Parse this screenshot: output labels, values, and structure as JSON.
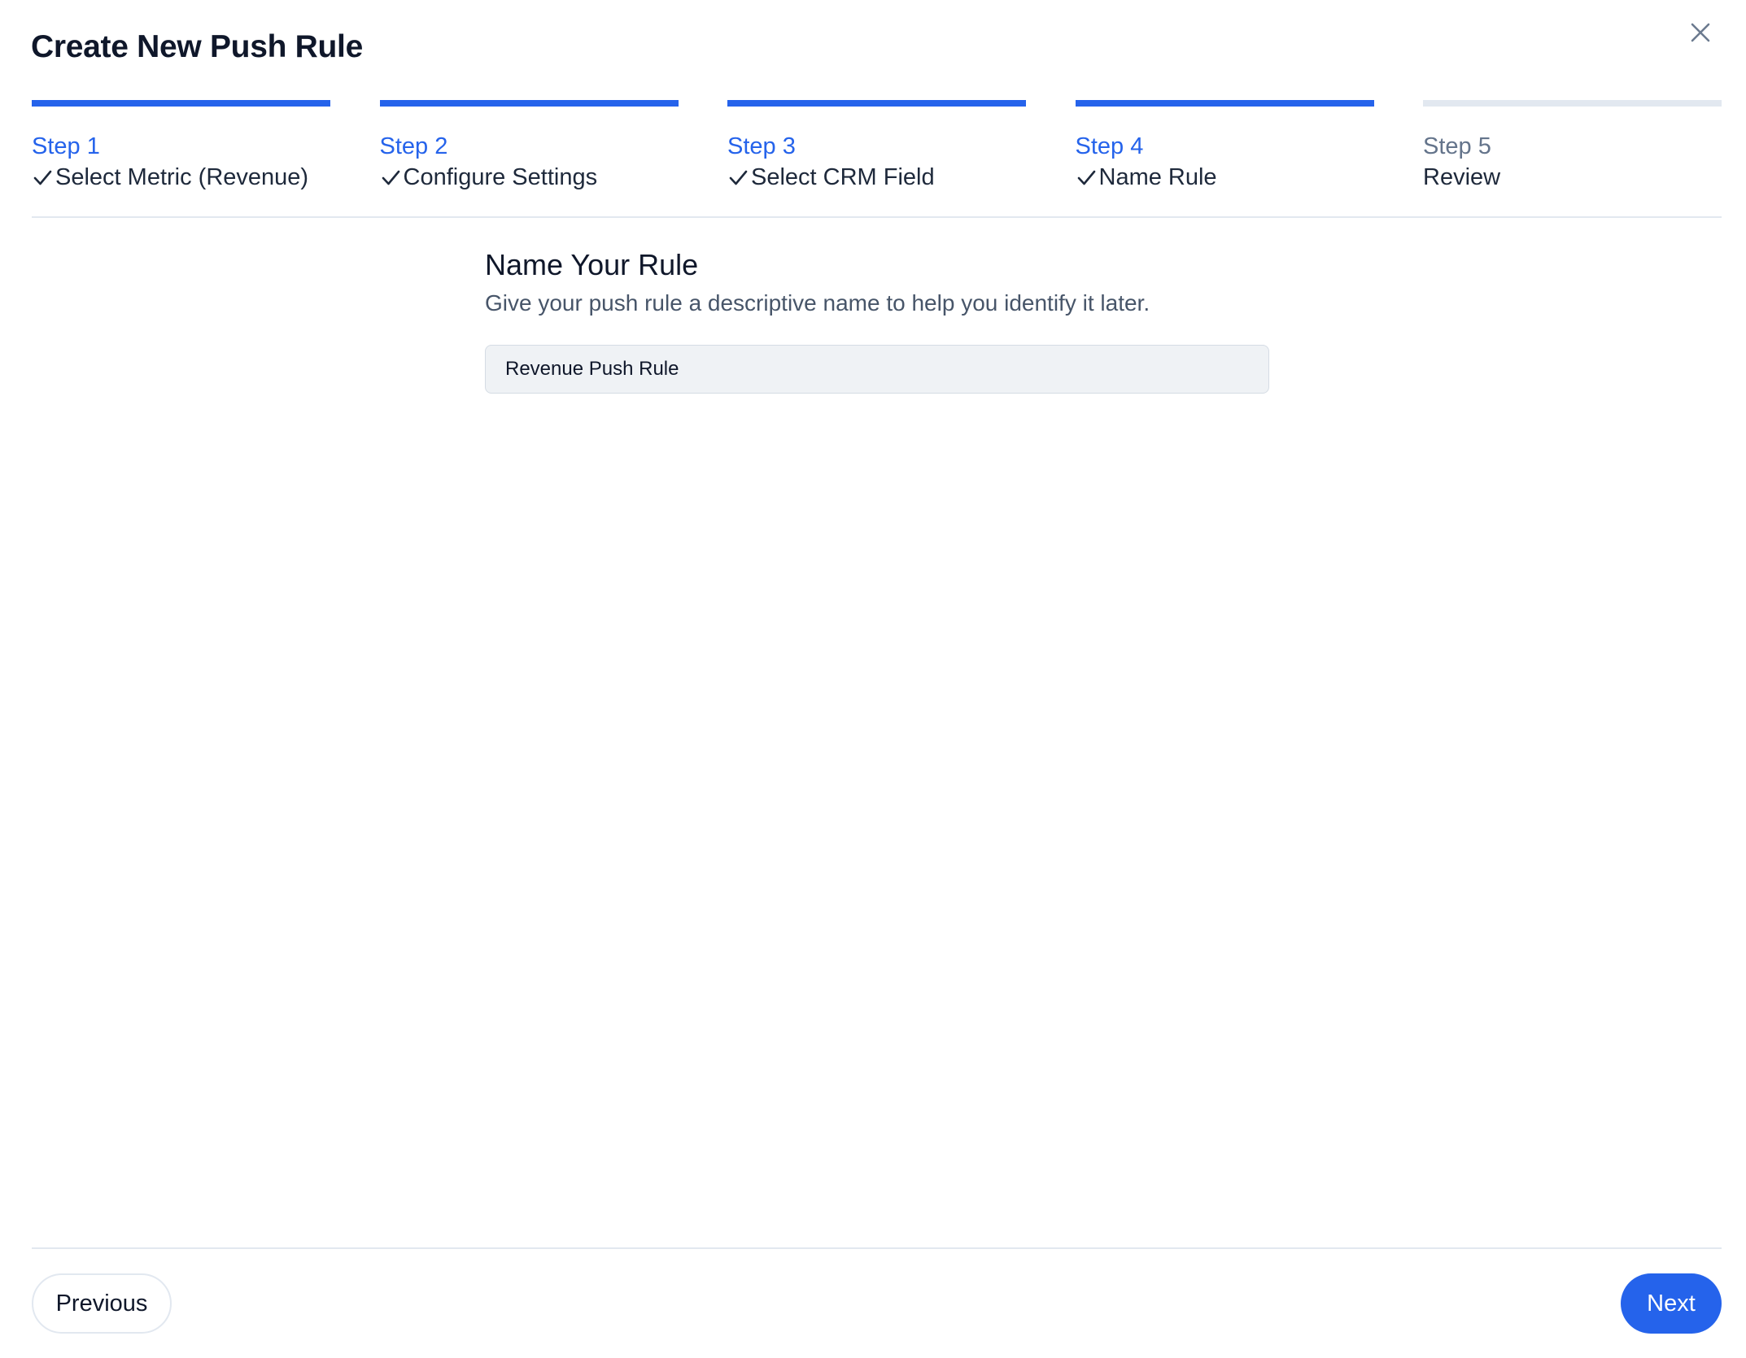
{
  "dialog": {
    "title": "Create New Push Rule",
    "close_icon": "close-icon"
  },
  "steps": [
    {
      "number": "Step 1",
      "label": "Select Metric (Revenue)",
      "status": "complete"
    },
    {
      "number": "Step 2",
      "label": "Configure Settings",
      "status": "complete"
    },
    {
      "number": "Step 3",
      "label": "Select CRM Field",
      "status": "complete"
    },
    {
      "number": "Step 4",
      "label": "Name Rule",
      "status": "complete"
    },
    {
      "number": "Step 5",
      "label": "Review",
      "status": "pending"
    }
  ],
  "content": {
    "heading": "Name Your Rule",
    "description": "Give your push rule a descriptive name to help you identify it later.",
    "rule_name_value": "Revenue Push Rule"
  },
  "footer": {
    "previous_label": "Previous",
    "next_label": "Next"
  },
  "colors": {
    "accent": "#2563eb",
    "pending_bar": "#e2e8f0",
    "input_bg": "#eff2f5"
  }
}
